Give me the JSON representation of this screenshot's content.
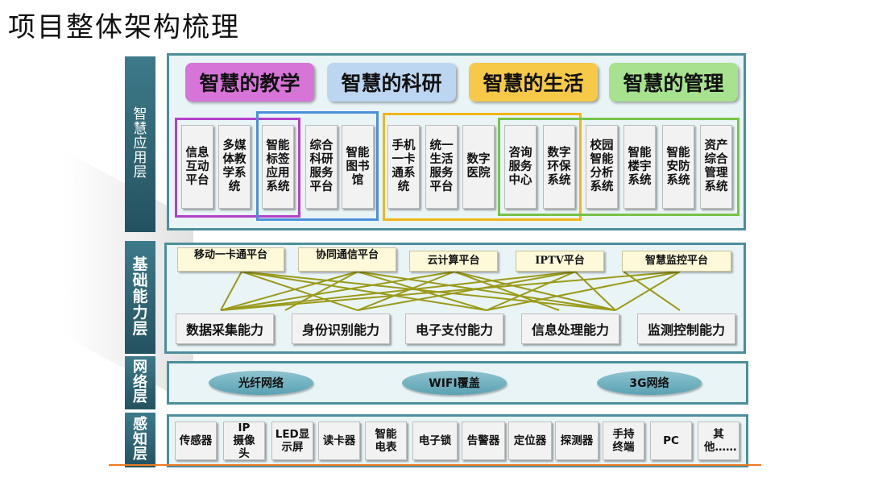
{
  "title": "项目整体架构梳理",
  "layers": {
    "application": "智慧应用层",
    "capability": "基础能力层",
    "network": "网络层",
    "perception": "感知层"
  },
  "categories": [
    {
      "label": "智慧的教学",
      "color": "#d774d7"
    },
    {
      "label": "智慧的科研",
      "color": "#bcd6f2"
    },
    {
      "label": "智慧的生活",
      "color": "#f7c948"
    },
    {
      "label": "智慧的管理",
      "color": "#a7e28e"
    }
  ],
  "group_colors": [
    "#b440c8",
    "#4a90d9",
    "#f2b51b",
    "#79c24a"
  ],
  "apps": [
    "信息互动平台",
    "多媒体教学系统",
    "智能标签应用系统",
    "综合科研服务平台",
    "智能图书馆",
    "手机一卡通系统",
    "统一生活服务平台",
    "数字医院",
    "咨询服务中心",
    "数字环保系统",
    "校园智能分析系统",
    "智能楼宇系统",
    "智能安防系统",
    "资产综合管理系统"
  ],
  "platforms": [
    "移动一卡通平台",
    "协同通信平台",
    "云计算平台",
    "IPTV平台",
    "智慧监控平台"
  ],
  "capabilities": [
    "数据采集能力",
    "身份识别能力",
    "电子支付能力",
    "信息处理能力",
    "监测控制能力"
  ],
  "networks": [
    "光纤网络",
    "WIFI覆盖",
    "3G网络"
  ],
  "devices": [
    "传感器",
    "IP摄像头",
    "LED显示屏",
    "读卡器",
    "智能电表",
    "电子锁",
    "告警器",
    "定位器",
    "探测器",
    "手持终端",
    "PC",
    "其他……"
  ]
}
